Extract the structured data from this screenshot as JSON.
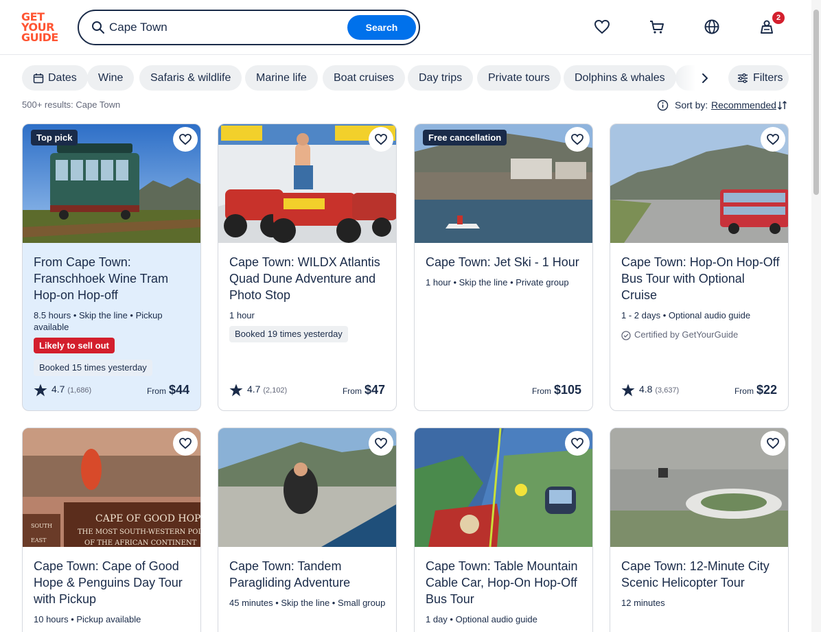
{
  "brand": {
    "logo_line1": "GET",
    "logo_line2": "YOUR",
    "logo_line3": "GUIDE",
    "color": "#ff5533"
  },
  "search": {
    "value": "Cape Town",
    "button": "Search"
  },
  "header": {
    "cart_badge": "2"
  },
  "chips": [
    "Dates",
    "Wine",
    "Safaris & wildlife",
    "Marine life",
    "Boat cruises",
    "Day trips",
    "Private tours",
    "Dolphins & whales"
  ],
  "filters_label": "Filters",
  "results": {
    "count": "500+ results: Cape Town",
    "sort_label": "Sort by:",
    "sort_value": "Recommended"
  },
  "cards": [
    {
      "tag": "Top pick",
      "title": "From Cape Town: Franschhoek Wine Tram Hop-on Hop-off",
      "meta": "8.5 hours • Skip the line • Pickup available",
      "urgency": "Likely to sell out",
      "booked": "Booked 15 times yesterday",
      "rating": "4.7",
      "reviews": "(1,686)",
      "from": "From",
      "price": "$44"
    },
    {
      "title": "Cape Town: WILDX Atlantis Quad Dune Adventure and Photo Stop",
      "meta": "1 hour",
      "booked": "Booked 19 times yesterday",
      "rating": "4.7",
      "reviews": "(2,102)",
      "from": "From",
      "price": "$47"
    },
    {
      "tag": "Free cancellation",
      "title": "Cape Town: Jet Ski - 1 Hour",
      "meta": "1 hour • Skip the line • Private group",
      "from": "From",
      "price": "$105"
    },
    {
      "title": "Cape Town: Hop-On Hop-Off Bus Tour with Optional Cruise",
      "meta": "1 - 2 days • Optional audio guide",
      "certified": "Certified by GetYourGuide",
      "rating": "4.8",
      "reviews": "(3,637)",
      "from": "From",
      "price": "$22"
    },
    {
      "title": "Cape Town: Cape of Good Hope & Penguins Day Tour with Pickup",
      "meta": "10 hours • Pickup available",
      "sign_line1": "CAPE OF GOOD HOPE",
      "sign_line2": "THE MOST SOUTH-WESTERN POINT",
      "sign_line3": "OF THE AFRICAN CONTINENT",
      "sign_side1": "SOUTH",
      "sign_side2": "EAST"
    },
    {
      "title": "Cape Town: Tandem Paragliding Adventure",
      "meta": "45 minutes • Skip the line • Small group"
    },
    {
      "title": "Cape Town: Table Mountain Cable Car, Hop-On Hop-Off Bus Tour",
      "meta": "1 day • Optional audio guide"
    },
    {
      "title": "Cape Town: 12-Minute City Scenic Helicopter Tour",
      "meta": "12 minutes"
    }
  ]
}
